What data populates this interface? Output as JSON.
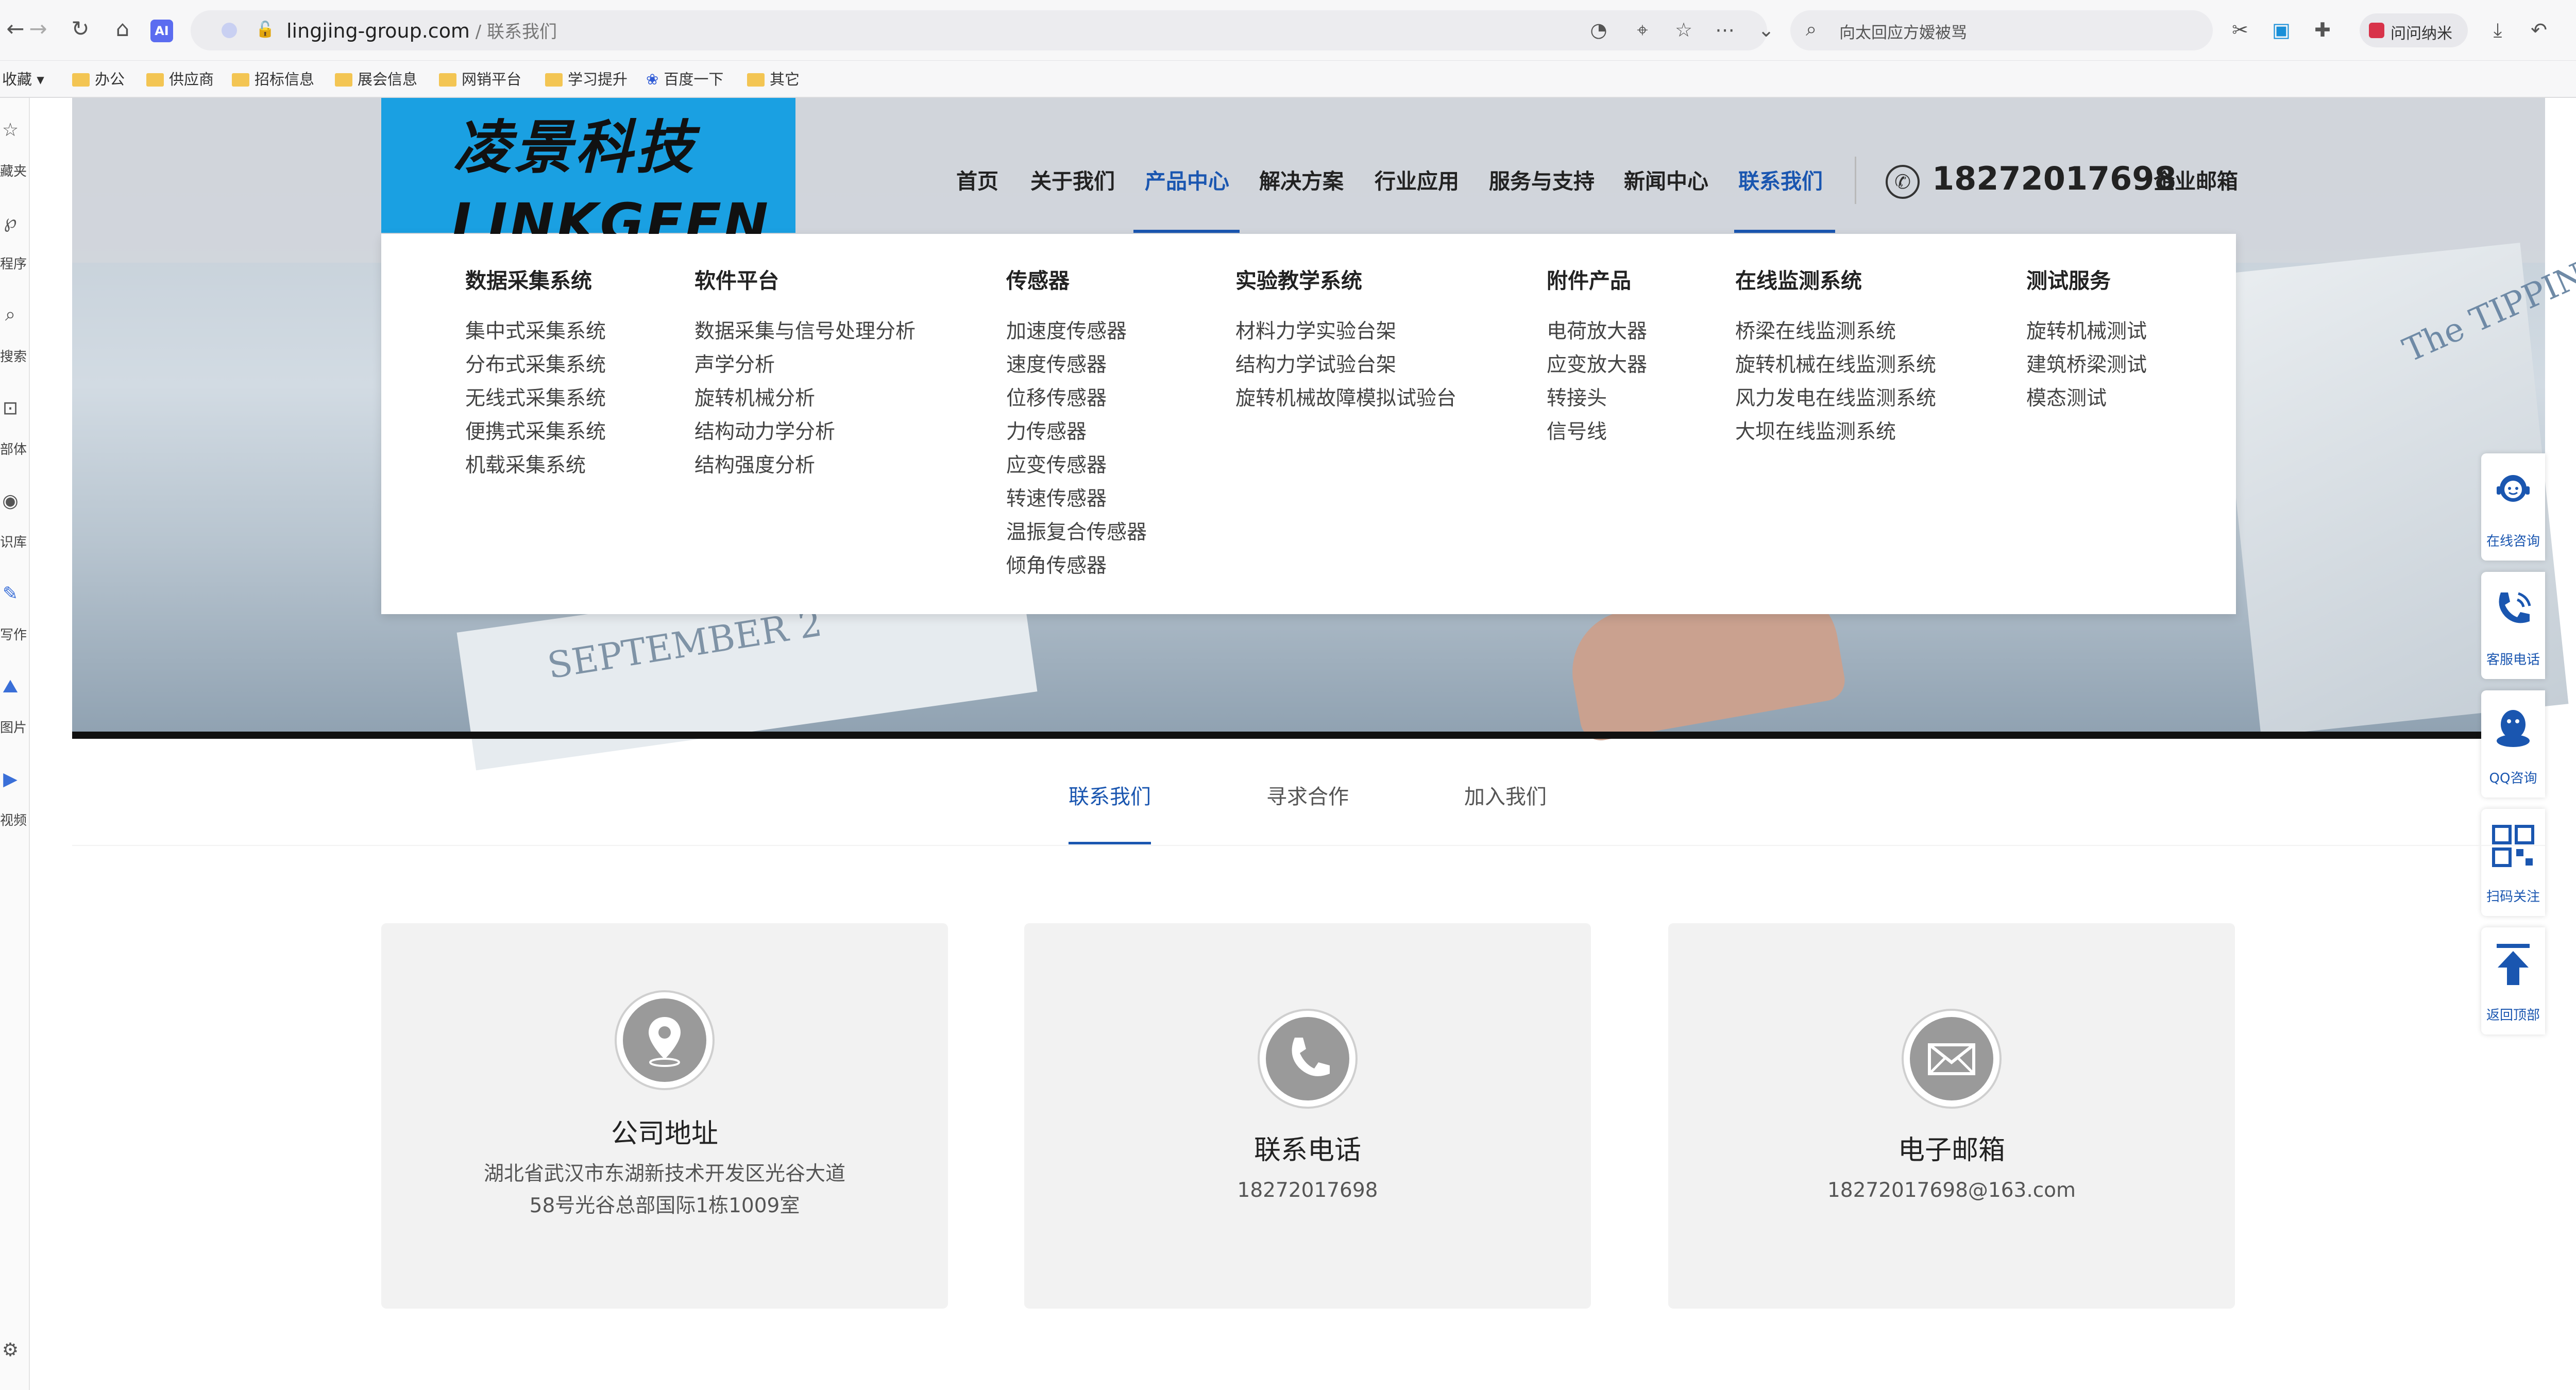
{
  "browser": {
    "url_domain": "lingjing-group.com",
    "url_sep_path": " / 联系我们",
    "search_placeholder": "向太回应方嫒被骂",
    "profile_label": "问问纳米",
    "ai_badge": "AI"
  },
  "bookmarks": [
    "收藏",
    "办公",
    "供应商",
    "招标信息",
    "展会信息",
    "网销平台",
    "学习提升",
    "百度一下",
    "其它"
  ],
  "sidebar": [
    "藏夹",
    "程序",
    "搜索",
    "部体",
    "识库",
    "写作",
    "图片",
    "视频"
  ],
  "site": {
    "logo_cn": "凌景科技",
    "logo_en": "LINKGEEN",
    "nav": [
      "首页",
      "关于我们",
      "产品中心",
      "解决方案",
      "行业应用",
      "服务与支持",
      "新闻中心",
      "联系我们"
    ],
    "phone": "18272017698",
    "mail_link": "企业邮箱"
  },
  "mega_menu": [
    {
      "head": "数据采集系统",
      "items": [
        "集中式采集系统",
        "分布式采集系统",
        "无线式采集系统",
        "便携式采集系统",
        "机载采集系统"
      ]
    },
    {
      "head": "软件平台",
      "items": [
        "数据采集与信号处理分析",
        "声学分析",
        "旋转机械分析",
        "结构动力学分析",
        "结构强度分析"
      ]
    },
    {
      "head": "传感器",
      "items": [
        "加速度传感器",
        "速度传感器",
        "位移传感器",
        "力传感器",
        "应变传感器",
        "转速传感器",
        "温振复合传感器",
        "倾角传感器"
      ]
    },
    {
      "head": "实验教学系统",
      "items": [
        "材料力学实验台架",
        "结构力学试验台架",
        "旋转机械故障模拟试验台"
      ]
    },
    {
      "head": "附件产品",
      "items": [
        "电荷放大器",
        "应变放大器",
        "转接头",
        "信号线"
      ]
    },
    {
      "head": "在线监测系统",
      "items": [
        "桥梁在线监测系统",
        "旋转机械在线监测系统",
        "风力发电在线监测系统",
        "大坝在线监测系统"
      ]
    },
    {
      "head": "测试服务",
      "items": [
        "旋转机械测试",
        "建筑桥梁测试",
        "模态测试"
      ]
    }
  ],
  "hero": {
    "book_text": "The TIPPING",
    "notebook_text": "SEPTEMBER 2"
  },
  "floating_tools": [
    "在线咨询",
    "客服电话",
    "QQ咨询",
    "扫码关注",
    "返回顶部"
  ],
  "tabs": [
    "联系我们",
    "寻求合作",
    "加入我们"
  ],
  "cards": [
    {
      "title": "公司地址",
      "line1": "湖北省武汉市东湖新技术开发区光谷大道",
      "line2": "58号光谷总部国际1栋1009室"
    },
    {
      "title": "联系电话",
      "line1": "18272017698"
    },
    {
      "title": "电子邮箱",
      "line1": "18272017698@163.com"
    }
  ],
  "colors": {
    "accent": "#1a56b0",
    "logo_bg": "#1aa0e2",
    "card_bg": "#f2f2f2",
    "icon_grey": "#9a9a9a"
  }
}
